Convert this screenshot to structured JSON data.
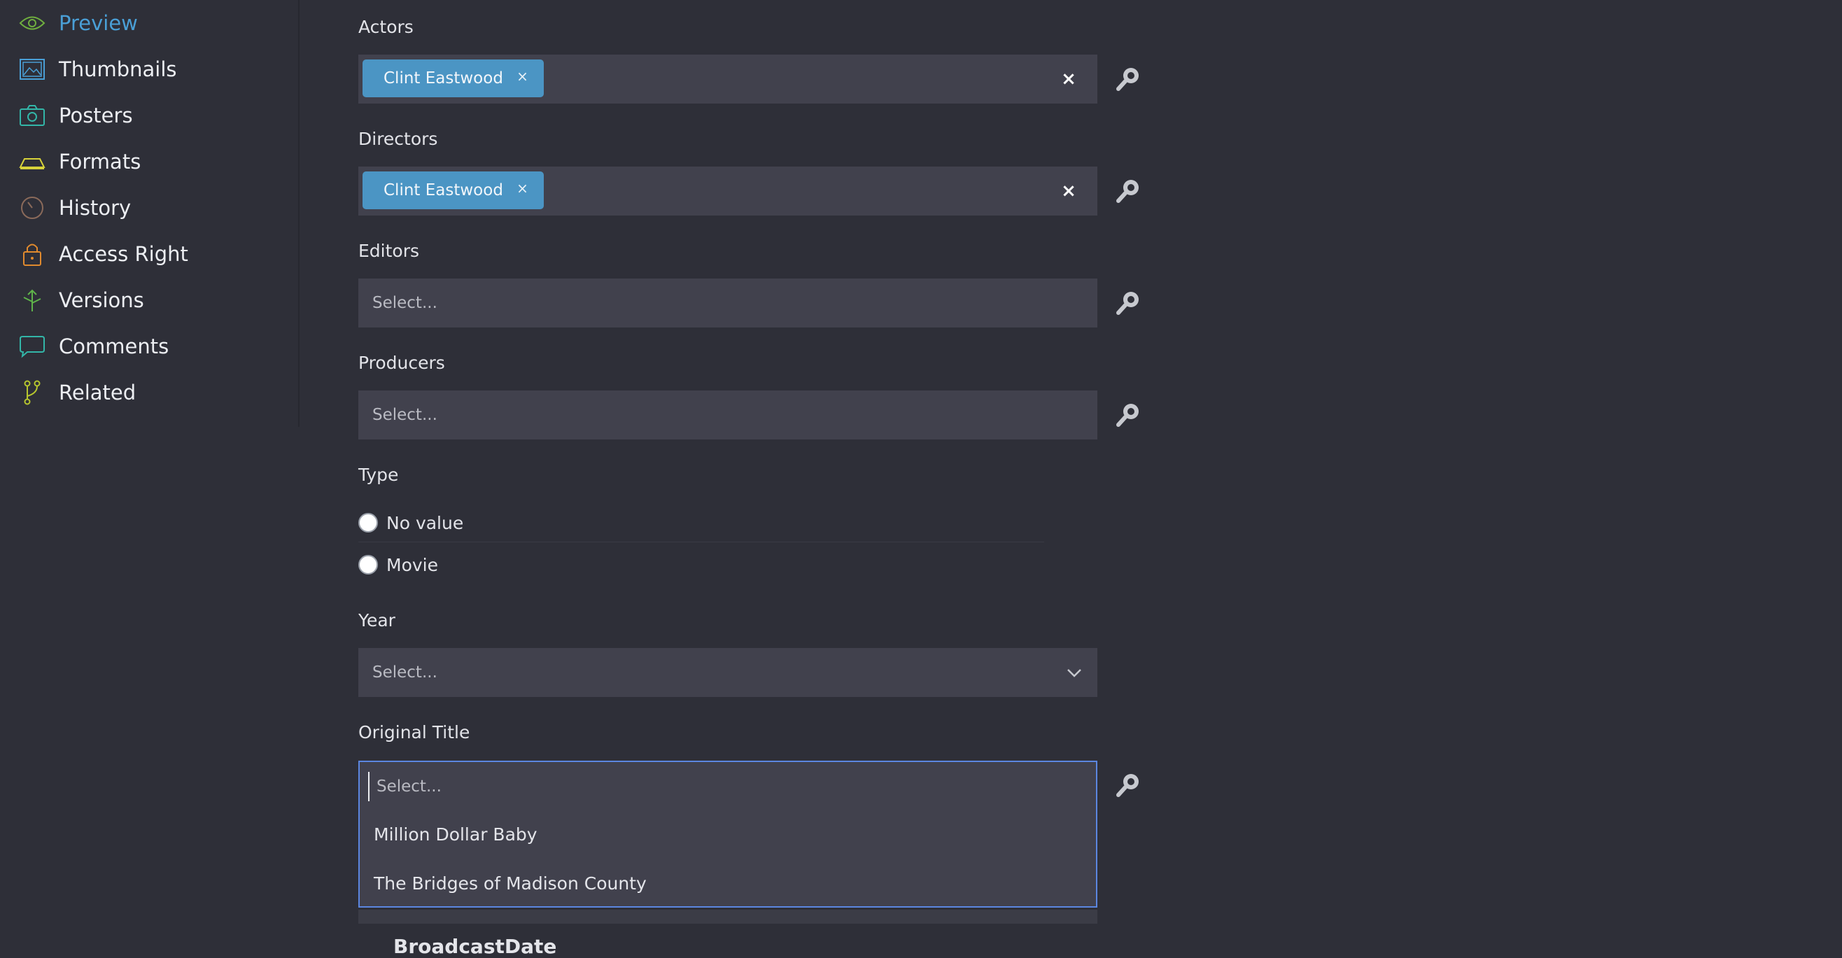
{
  "sidebar": {
    "items": [
      {
        "label": "Preview",
        "icon": "eye-icon",
        "active": true
      },
      {
        "label": "Thumbnails",
        "icon": "image-icon"
      },
      {
        "label": "Posters",
        "icon": "camera-icon"
      },
      {
        "label": "Formats",
        "icon": "formats-icon"
      },
      {
        "label": "History",
        "icon": "history-icon"
      },
      {
        "label": "Access Right",
        "icon": "lock-icon"
      },
      {
        "label": "Versions",
        "icon": "versions-icon"
      },
      {
        "label": "Comments",
        "icon": "comment-icon"
      },
      {
        "label": "Related",
        "icon": "branch-icon"
      }
    ]
  },
  "form": {
    "actors": {
      "label": "Actors",
      "tags": [
        "Clint Eastwood"
      ]
    },
    "directors": {
      "label": "Directors",
      "tags": [
        "Clint Eastwood"
      ]
    },
    "editors": {
      "label": "Editors",
      "placeholder": "Select..."
    },
    "producers": {
      "label": "Producers",
      "placeholder": "Select..."
    },
    "type": {
      "label": "Type",
      "options": [
        "No value",
        "Movie"
      ]
    },
    "year": {
      "label": "Year",
      "placeholder": "Select..."
    },
    "original_title": {
      "label": "Original Title",
      "placeholder": "Select...",
      "options": [
        "Million Dollar Baby",
        "The Bridges of Madison County"
      ]
    },
    "next_field_label": "BroadcastDate"
  },
  "colors": {
    "background": "#2e2f38",
    "input_bg": "#41414d",
    "tag_bg": "#4b95c4",
    "active_nav": "#4a9fd6",
    "focus_border": "#5b86e0"
  }
}
